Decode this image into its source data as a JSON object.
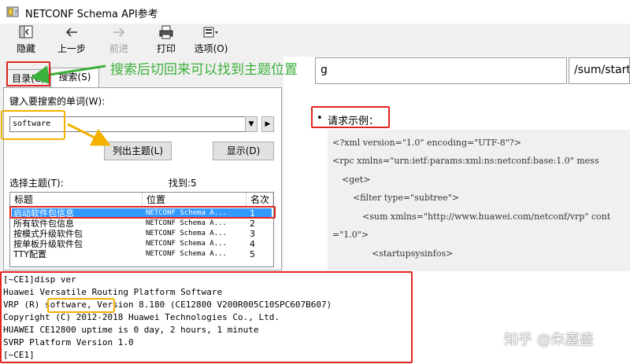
{
  "window": {
    "title": "NETCONF Schema API参考"
  },
  "toolbar": {
    "items": [
      {
        "label": "隐藏",
        "icon": "hide-pane-icon"
      },
      {
        "label": "上一步",
        "icon": "back-arrow-icon"
      },
      {
        "label": "前进",
        "icon": "forward-arrow-icon"
      },
      {
        "label": "打印",
        "icon": "printer-icon"
      },
      {
        "label": "选项(O)",
        "icon": "options-icon"
      }
    ]
  },
  "tabs": [
    {
      "label": "目录(C)"
    },
    {
      "label": "搜索(S)"
    }
  ],
  "search": {
    "prompt": "键入要搜索的单词(W):",
    "value": "software",
    "list_topics_label": "列出主题(L)",
    "display_label": "显示(D)",
    "select_topic_label": "选择主题(T):",
    "found_label": "找到:5",
    "columns": [
      "标题",
      "位置",
      "名次"
    ],
    "results": [
      {
        "title": "启动软件包信息",
        "location": "NETCONF Schema A...",
        "rank": "1"
      },
      {
        "title": "所有软件包信息",
        "location": "NETCONF Schema A...",
        "rank": "2"
      },
      {
        "title": "按模式升级软件包",
        "location": "NETCONF Schema A...",
        "rank": "3"
      },
      {
        "title": "按单板升级软件包",
        "location": "NETCONF Schema A...",
        "rank": "4"
      },
      {
        "title": "TTY配置",
        "location": "NETCONF Schema A...",
        "rank": "5"
      }
    ]
  },
  "annotation": {
    "text": "搜索后切回来可以找到主题位置"
  },
  "content": {
    "path_left": "g",
    "path_right": "/sum/startu",
    "section_bullet": "•",
    "section_title": "请求示例：",
    "code_lines": [
      "<?xml version=\"1.0\" encoding=\"UTF-8\"?>",
      "<rpc xmlns=\"urn:ietf:params:xml:ns:netconf:base:1.0\" mess",
      "<get>",
      "<filter type=\"subtree\">",
      "<sum xmlns=\"http://www.huawei.com/netconf/vrp\" cont",
      "=\"1.0\">",
      "<startupsysinfos>"
    ]
  },
  "terminal": {
    "lines": [
      "[~CE1]disp ver",
      "Huawei Versatile Routing Platform Software",
      "VRP (R) software, Version 8.180 (CE12800 V200R005C10SPC607B607)",
      "Copyright (C) 2012-2018 Huawei Technologies Co., Ltd.",
      "HUAWEI CE12800 uptime is 0 day, 2 hours, 1 minute",
      "SVRP Platform Version 1.0",
      "[~CE1]"
    ]
  },
  "watermark": {
    "text": "知乎 @朱嘉盛"
  },
  "colors": {
    "annotation_red": "#e0251f",
    "annotation_yellow": "#f3b000",
    "annotation_green": "#3bb03b",
    "selection_blue": "#3399ff"
  }
}
